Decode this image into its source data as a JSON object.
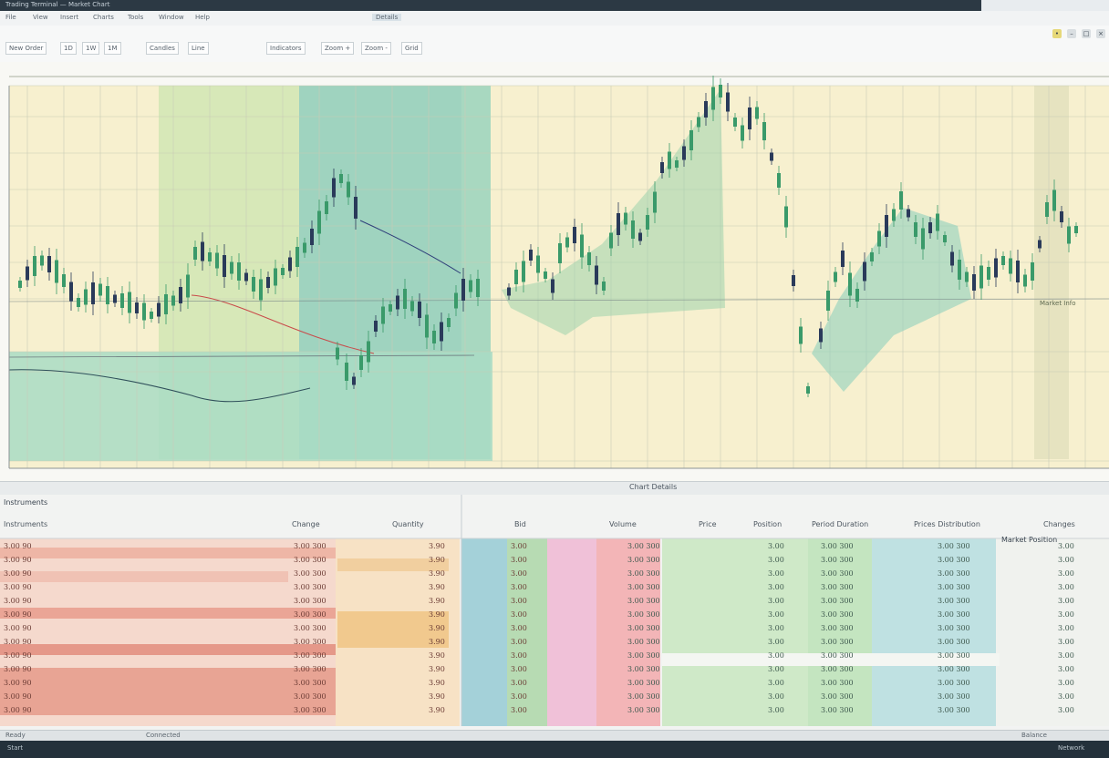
{
  "app": {
    "title": "Trading Terminal — Market Chart",
    "tab": "Details"
  },
  "menu": [
    "File",
    "View",
    "Insert",
    "Charts",
    "Tools",
    "Window",
    "Help"
  ],
  "toolbar": {
    "buttons": [
      "New Order",
      "1D",
      "1W",
      "1M",
      "Candles",
      "Line",
      "Indicators",
      "Zoom +",
      "Zoom -",
      "Grid"
    ]
  },
  "chart": {
    "info_label": "Chart Details",
    "marker": "Market Info"
  },
  "table": {
    "left_header": "Instruments",
    "headers": [
      "Change",
      "Quantity",
      "Bid",
      "Volume",
      "Price",
      "Position",
      "Period Duration",
      "Prices Distribution",
      "Changes"
    ],
    "sub_header": "Market Position",
    "col1": [
      "3.00 90",
      "3.00 90",
      "3.00 90",
      "3.00 90",
      "3.00 90",
      "3.00 90",
      "3.00 90",
      "3.00 90",
      "3.00 90",
      "3.00 90",
      "3.00 90",
      "3.00 90",
      "3.00 90"
    ],
    "col2": [
      "3.00 300",
      "3.00 300",
      "3.00 300",
      "3.00 300",
      "3.00 300",
      "3.00 300",
      "3.00 300",
      "3.00 300",
      "3.00 300",
      "3.00 300",
      "3.00 300",
      "3.00 300",
      "3.00 300"
    ],
    "col3": [
      "3.90",
      "3.90",
      "3.90",
      "3.90",
      "3.90",
      "3.90",
      "3.90",
      "3.90",
      "3.90",
      "3.90",
      "3.90",
      "3.90",
      "3.90"
    ],
    "col4": [
      "3.00",
      "3.00",
      "3.00",
      "3.00",
      "3.00",
      "3.00",
      "3.00",
      "3.00",
      "3.00",
      "3.00",
      "3.00",
      "3.00",
      "3.00"
    ],
    "col5": [
      "3.00 300",
      "3.00 300",
      "3.00 300",
      "3.00 300",
      "3.00 300",
      "3.00 300",
      "3.00 300",
      "3.00 300",
      "3.00 300",
      "3.00 300",
      "3.00 300",
      "3.00 300",
      "3.00 300"
    ],
    "col6": [
      "3.00",
      "3.00",
      "3.00",
      "3.00",
      "3.00",
      "3.00",
      "3.00",
      "3.00",
      "3.00",
      "3.00",
      "3.00",
      "3.00",
      "3.00"
    ],
    "col7": [
      "3.00 300",
      "3.00 300",
      "3.00 300",
      "3.00 300",
      "3.00 300",
      "3.00 300",
      "3.00 300",
      "3.00 300",
      "3.00 300",
      "3.00 300",
      "3.00 300",
      "3.00 300",
      "3.00 300"
    ],
    "col8": [
      "3.00 300",
      "3.00 300",
      "3.00 300",
      "3.00 300",
      "3.00 300",
      "3.00 300",
      "3.00 300",
      "3.00 300",
      "3.00 300",
      "3.00 300",
      "3.00 300",
      "3.00 300",
      "3.00 300"
    ],
    "col9": [
      "3.00",
      "3.00",
      "3.00",
      "3.00",
      "3.00",
      "3.00",
      "3.00",
      "3.00",
      "3.00",
      "3.00",
      "3.00",
      "3.00",
      "3.00"
    ]
  },
  "status": {
    "left": "Ready",
    "mid": "Connected",
    "right": "Balance"
  },
  "taskbar": {
    "left": "Start",
    "right": "Network"
  },
  "colors": {
    "bull": "#3a9a6a",
    "bear": "#2a3a5a",
    "panel": "#f8f8f4"
  }
}
